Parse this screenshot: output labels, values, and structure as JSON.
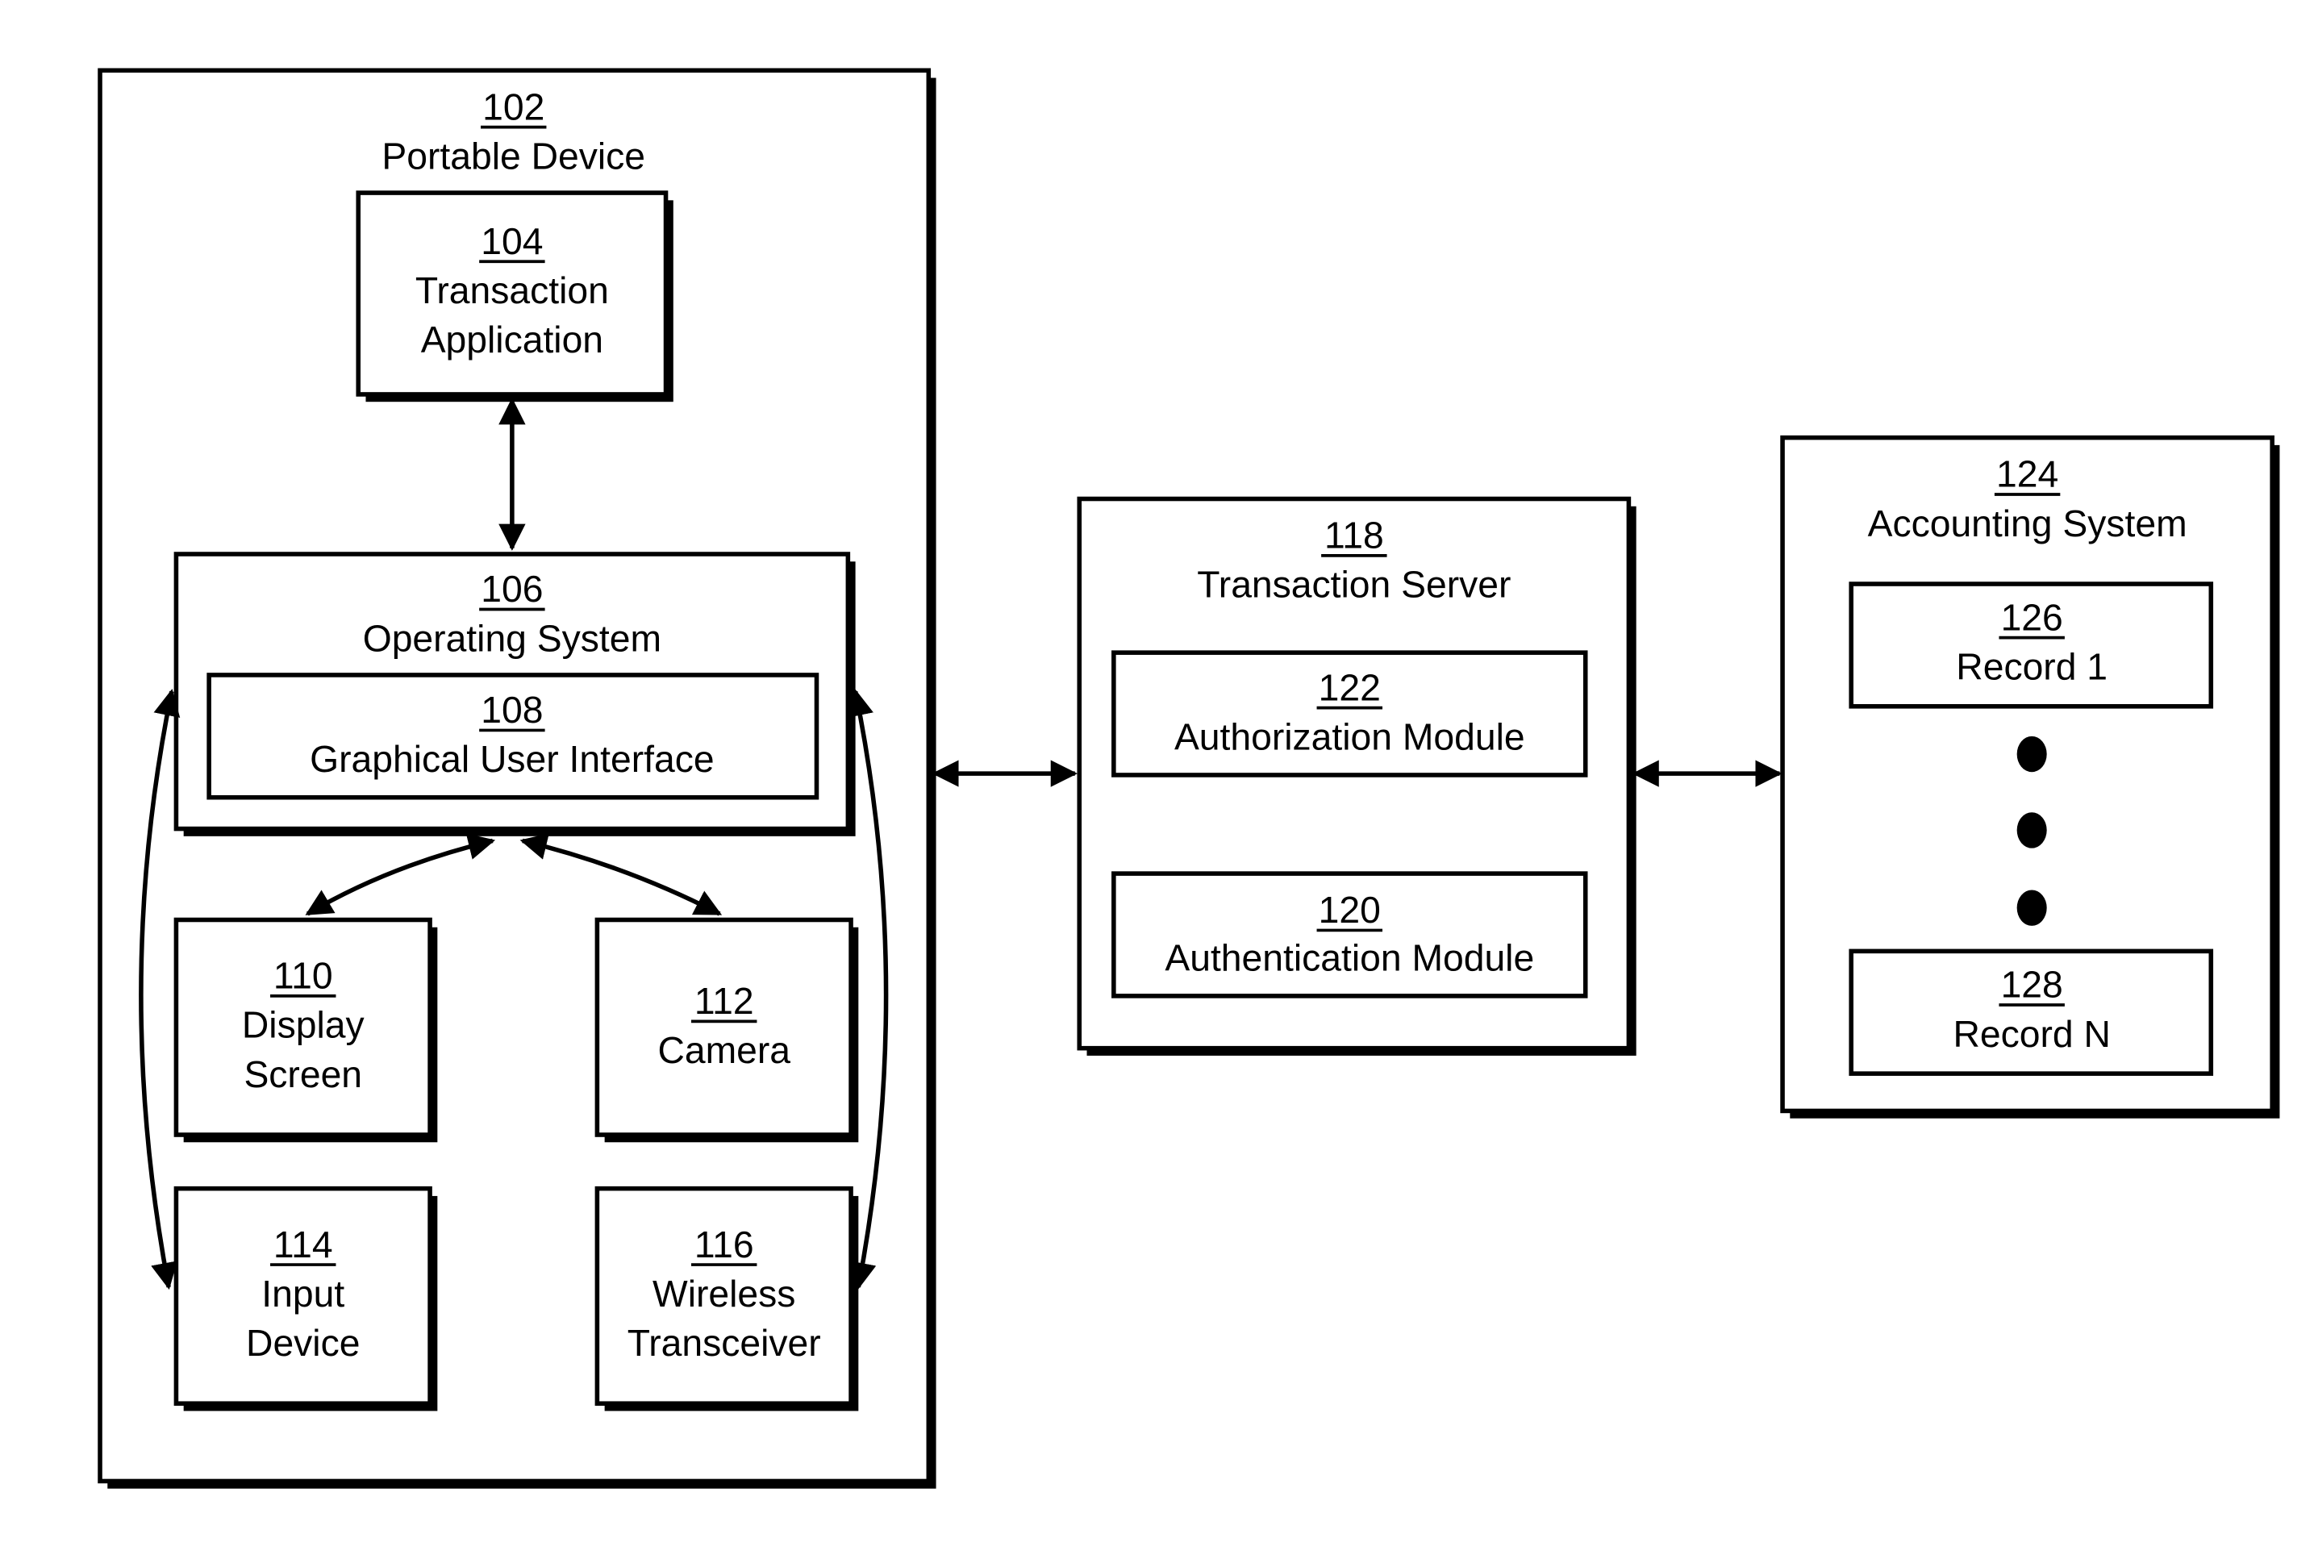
{
  "diagram": {
    "portable_device": {
      "ref": "102",
      "label": "Portable Device"
    },
    "transaction_application": {
      "ref": "104",
      "line1": "Transaction",
      "line2": "Application"
    },
    "operating_system": {
      "ref": "106",
      "label": "Operating System"
    },
    "gui": {
      "ref": "108",
      "label": "Graphical User Interface"
    },
    "display_screen": {
      "ref": "110",
      "line1": "Display",
      "line2": "Screen"
    },
    "camera": {
      "ref": "112",
      "label": "Camera"
    },
    "input_device": {
      "ref": "114",
      "line1": "Input",
      "line2": "Device"
    },
    "wireless_transceiver": {
      "ref": "116",
      "line1": "Wireless",
      "line2": "Transceiver"
    },
    "transaction_server": {
      "ref": "118",
      "label": "Transaction Server"
    },
    "authorization_module": {
      "ref": "122",
      "label": "Authorization Module"
    },
    "authentication_module": {
      "ref": "120",
      "label": "Authentication Module"
    },
    "accounting_system": {
      "ref": "124",
      "label": "Accounting System"
    },
    "record_1": {
      "ref": "126",
      "label": "Record 1"
    },
    "record_n": {
      "ref": "128",
      "label": "Record N"
    }
  }
}
